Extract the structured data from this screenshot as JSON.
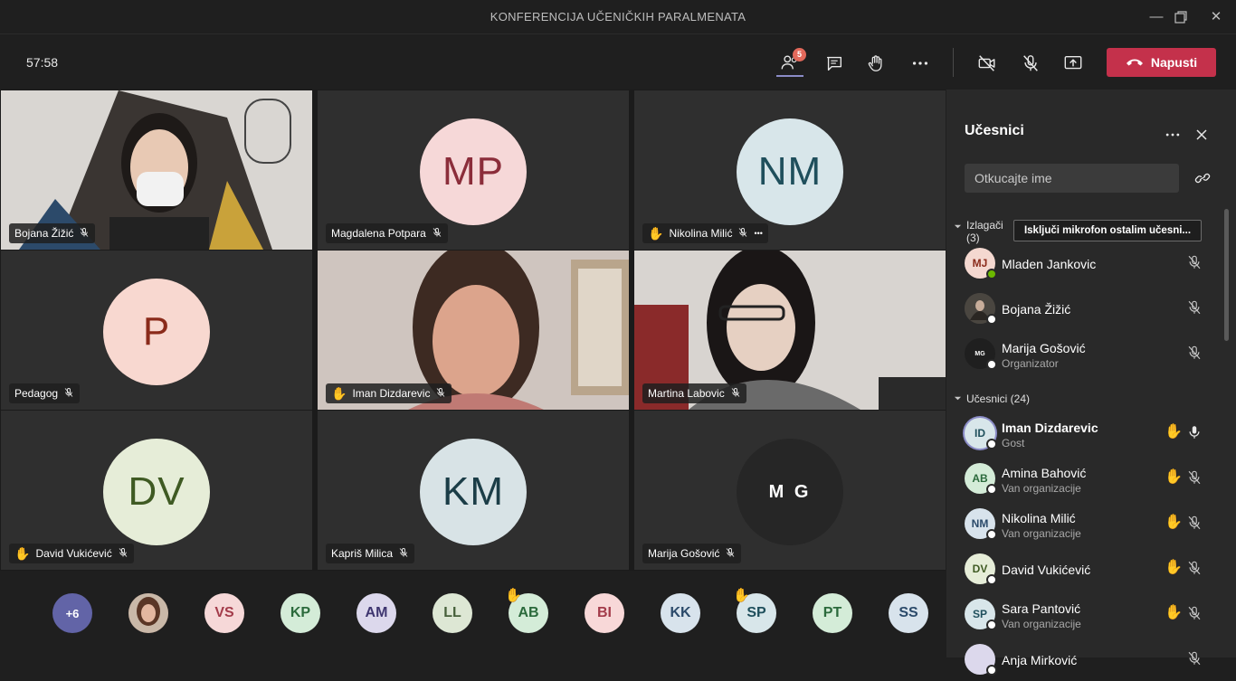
{
  "window": {
    "title": "KONFERENCIJA UČENIČKIH PARALMENATA"
  },
  "toolbar": {
    "timer": "57:58",
    "participants_badge": "5",
    "leave_label": "Napusti"
  },
  "tiles": [
    {
      "name": "Bojana Žižić",
      "type": "photo",
      "hand": false,
      "more": false
    },
    {
      "name": "Magdalena Potpara",
      "type": "avatar",
      "initials": "MP",
      "bg": "#f6d8d8",
      "fg": "#8b2d3a",
      "hand": false,
      "more": false
    },
    {
      "name": "Nikolina Milić",
      "type": "avatar",
      "initials": "NM",
      "bg": "#d8e6ea",
      "fg": "#1f4f5c",
      "hand": true,
      "more": true
    },
    {
      "name": "Pedagog",
      "type": "avatar",
      "initials": "P",
      "bg": "#f8d8d0",
      "fg": "#8a2a1a",
      "hand": false,
      "more": false
    },
    {
      "name": "Iman Dizdarevic",
      "type": "photo",
      "hand": true,
      "more": false
    },
    {
      "name": "Martina Labovic",
      "type": "photo",
      "hand": false,
      "more": false
    },
    {
      "name": "David Vukićević",
      "type": "avatar",
      "initials": "DV",
      "bg": "#e6edd8",
      "fg": "#3f5a23",
      "hand": true,
      "more": false
    },
    {
      "name": "Kapriš Milica",
      "type": "avatar",
      "initials": "KM",
      "bg": "#d8e3e6",
      "fg": "#1b3d47",
      "hand": false,
      "more": false
    },
    {
      "name": "Marija Gošović",
      "type": "avatar",
      "initials": "M G",
      "bg": "#262626",
      "fg": "#ffffff",
      "hand": false,
      "more": false
    }
  ],
  "strip": [
    {
      "label": "+6",
      "bg": "#6264a7",
      "fg": "#ffffff",
      "hand": false
    },
    {
      "label": "",
      "bg": "#7a5040",
      "fg": "#ffffff",
      "hand": false,
      "photo": true
    },
    {
      "label": "VS",
      "bg": "#f6d8d8",
      "fg": "#a33b4a",
      "hand": false
    },
    {
      "label": "KP",
      "bg": "#d4ecd8",
      "fg": "#2b6a3c",
      "hand": false
    },
    {
      "label": "AM",
      "bg": "#dcd8ec",
      "fg": "#3f3670",
      "hand": false
    },
    {
      "label": "LL",
      "bg": "#dde7d4",
      "fg": "#46603a",
      "hand": false
    },
    {
      "label": "AB",
      "bg": "#d4ecd8",
      "fg": "#2b6a3c",
      "hand": true
    },
    {
      "label": "BI",
      "bg": "#f8d8d8",
      "fg": "#a33b4a",
      "hand": false
    },
    {
      "label": "KK",
      "bg": "#d8e3ec",
      "fg": "#2b4a6a",
      "hand": false
    },
    {
      "label": "SP",
      "bg": "#d8e6ea",
      "fg": "#1f4f5c",
      "hand": true
    },
    {
      "label": "PT",
      "bg": "#d4ecd8",
      "fg": "#2b6a3c",
      "hand": false
    },
    {
      "label": "SS",
      "bg": "#d8e3ec",
      "fg": "#2b4a6a",
      "hand": false
    }
  ],
  "panel": {
    "title": "Učesnici",
    "search_placeholder": "Otkucajte ime",
    "presenters_label": "Izlagači",
    "presenters_count": "(3)",
    "mute_all_label": "Isključi mikrofon ostalim učesni...",
    "attendees_label": "Učesnici (24)",
    "presenters": [
      {
        "initials": "MJ",
        "name": "Mladen Jankovic",
        "sub": "",
        "bg": "#f4d8d0",
        "fg": "#8a2a1a",
        "status": "#6bb700"
      },
      {
        "initials": "",
        "name": "Bojana Žižić",
        "sub": "",
        "bg": "#4a4640",
        "fg": "#ffffff",
        "status": "#ffffff",
        "photo": true
      },
      {
        "initials": "MG",
        "name": "Marija Gošović",
        "sub": "Organizator",
        "bg": "#1f1f1f",
        "fg": "#ffffff",
        "status": "#ffffff"
      }
    ],
    "attendees": [
      {
        "initials": "ID",
        "name": "Iman Dizdarevic",
        "sub": "Gost",
        "bg": "#d8e6ea",
        "fg": "#1f4f5c",
        "hand": true,
        "mic": "on",
        "bold": true
      },
      {
        "initials": "AB",
        "name": "Amina Bahović",
        "sub": "Van organizacije",
        "bg": "#d4ecd8",
        "fg": "#2b6a3c",
        "hand": true,
        "mic": "off"
      },
      {
        "initials": "NM",
        "name": "Nikolina Milić",
        "sub": "Van organizacije",
        "bg": "#d8e3ec",
        "fg": "#2b4a6a",
        "hand": true,
        "mic": "off"
      },
      {
        "initials": "DV",
        "name": "David Vukićević",
        "sub": "",
        "bg": "#e6edd8",
        "fg": "#3f5a23",
        "hand": true,
        "mic": "off"
      },
      {
        "initials": "SP",
        "name": "Sara Pantović",
        "sub": "Van organizacije",
        "bg": "#d8e6ea",
        "fg": "#1f4f5c",
        "hand": true,
        "mic": "off"
      },
      {
        "initials": "",
        "name": "Anja Mirković",
        "sub": "",
        "bg": "#dcd8ec",
        "fg": "#3f3670",
        "hand": false,
        "mic": "off"
      }
    ]
  }
}
